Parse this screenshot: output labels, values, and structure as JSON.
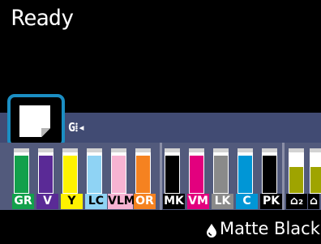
{
  "status": {
    "text": "Ready"
  },
  "head_icon": {
    "text": "G"
  },
  "inks": [
    {
      "label": "GR",
      "color": "#12a04b",
      "label_bg": "#12a04b",
      "label_fg": "#ffffff"
    },
    {
      "label": "V",
      "color": "#5a2a96",
      "label_bg": "#5a2a96",
      "label_fg": "#ffffff"
    },
    {
      "label": "Y",
      "color": "#fff200",
      "label_bg": "#fff200",
      "label_fg": "#000000"
    },
    {
      "label": "LC",
      "color": "#8fd3f4",
      "label_bg": "#8fd3f4",
      "label_fg": "#000000"
    },
    {
      "label": "VLM",
      "color": "#f7b3d2",
      "label_bg": "#f7b3d2",
      "label_fg": "#000000"
    },
    {
      "label": "OR",
      "color": "#f58220",
      "label_bg": "#f58220",
      "label_fg": "#ffffff"
    },
    {
      "label": "MK",
      "color": "#000000",
      "label_bg": "#000000",
      "label_fg": "#ffffff"
    },
    {
      "label": "VM",
      "color": "#e3007e",
      "label_bg": "#e3007e",
      "label_fg": "#ffffff"
    },
    {
      "label": "LK",
      "color": "#8a8a8a",
      "label_bg": "#8a8a8a",
      "label_fg": "#ffffff"
    },
    {
      "label": "C",
      "color": "#0096d6",
      "label_bg": "#0096d6",
      "label_fg": "#ffffff"
    },
    {
      "label": "PK",
      "color": "#000000",
      "label_bg": "#000000",
      "label_fg": "#ffffff"
    },
    {
      "label": "⌂₂",
      "color": "#9fa400",
      "label_bg": "#000000",
      "label_fg": "#ffffff"
    },
    {
      "label": "⌂",
      "color": "#9fa400",
      "label_bg": "#000000",
      "label_fg": "#ffffff"
    }
  ],
  "ink_levels": [
    0.85,
    0.85,
    0.85,
    0.85,
    0.85,
    0.85,
    0.85,
    0.85,
    0.85,
    0.85,
    0.85,
    0.6,
    0.6
  ],
  "selected_ink": {
    "label": "Matte Black"
  },
  "colors": {
    "paper_highlight": "#1b8ec3",
    "panel": "#525a7c",
    "bar": "#414b73"
  }
}
